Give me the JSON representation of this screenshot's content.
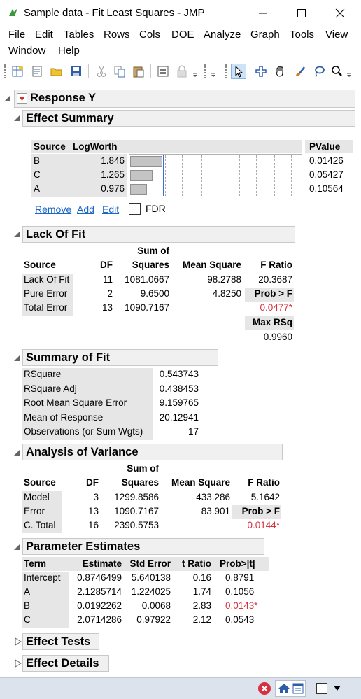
{
  "window": {
    "title": "Sample data - Fit Least Squares - JMP"
  },
  "menu": [
    "File",
    "Edit",
    "Tables",
    "Rows",
    "Cols",
    "DOE",
    "Analyze",
    "Graph",
    "Tools",
    "View",
    "Window",
    "Help"
  ],
  "report": {
    "response_title": "Response Y",
    "effect_summary": {
      "title": "Effect Summary",
      "headers": {
        "source": "Source",
        "logworth": "LogWorth",
        "pvalue": "PValue"
      },
      "rows": [
        {
          "source": "B",
          "logworth": "1.846",
          "pvalue": "0.01426",
          "bar": 1.846
        },
        {
          "source": "C",
          "logworth": "1.265",
          "pvalue": "0.05427",
          "bar": 1.265
        },
        {
          "source": "A",
          "logworth": "0.976",
          "pvalue": "0.10564",
          "bar": 0.976
        }
      ],
      "links": {
        "remove": "Remove",
        "add": "Add",
        "edit": "Edit"
      },
      "fdr_label": "FDR"
    },
    "lack_of_fit": {
      "title": "Lack Of Fit",
      "headers": {
        "source": "Source",
        "df": "DF",
        "ss_top": "Sum of",
        "ss_bottom": "Squares",
        "ms": "Mean Square",
        "f": "F Ratio"
      },
      "rows": [
        {
          "source": "Lack Of Fit",
          "df": "11",
          "ss": "1081.0667",
          "ms": "98.2788",
          "f": "20.3687"
        },
        {
          "source": "Pure Error",
          "df": "2",
          "ss": "9.6500",
          "ms": "4.8250",
          "f": "Prob > F"
        },
        {
          "source": "Total Error",
          "df": "13",
          "ss": "1090.7167",
          "ms": "",
          "f": "0.0477*"
        }
      ],
      "max_rsq_label": "Max RSq",
      "max_rsq_value": "0.9960"
    },
    "summary_of_fit": {
      "title": "Summary of Fit",
      "rows": [
        {
          "label": "RSquare",
          "value": "0.543743"
        },
        {
          "label": "RSquare Adj",
          "value": "0.438453"
        },
        {
          "label": "Root Mean Square Error",
          "value": "9.159765"
        },
        {
          "label": "Mean of Response",
          "value": "20.12941"
        },
        {
          "label": "Observations (or Sum Wgts)",
          "value": "17"
        }
      ]
    },
    "anova": {
      "title": "Analysis of Variance",
      "headers": {
        "source": "Source",
        "df": "DF",
        "ss_top": "Sum of",
        "ss_bottom": "Squares",
        "ms": "Mean Square",
        "f": "F Ratio"
      },
      "rows": [
        {
          "source": "Model",
          "df": "3",
          "ss": "1299.8586",
          "ms": "433.286",
          "f": "5.1642"
        },
        {
          "source": "Error",
          "df": "13",
          "ss": "1090.7167",
          "ms": "83.901",
          "f": "Prob > F"
        },
        {
          "source": "C. Total",
          "df": "16",
          "ss": "2390.5753",
          "ms": "",
          "f": "0.0144*"
        }
      ]
    },
    "parameter_estimates": {
      "title": "Parameter Estimates",
      "headers": {
        "term": "Term",
        "estimate": "Estimate",
        "stderr": "Std Error",
        "t": "t Ratio",
        "p": "Prob>|t|"
      },
      "rows": [
        {
          "term": "Intercept",
          "estimate": "0.8746499",
          "stderr": "5.640138",
          "t": "0.16",
          "p": "0.8791",
          "sig": false
        },
        {
          "term": "A",
          "estimate": "2.1285714",
          "stderr": "1.224025",
          "t": "1.74",
          "p": "0.1056",
          "sig": false
        },
        {
          "term": "B",
          "estimate": "0.0192262",
          "stderr": "0.0068",
          "t": "2.83",
          "p": "0.0143*",
          "sig": true
        },
        {
          "term": "C",
          "estimate": "2.0714286",
          "stderr": "0.97922",
          "t": "2.12",
          "p": "0.0543",
          "sig": false
        }
      ]
    },
    "effect_tests_title": "Effect Tests",
    "effect_details_title": "Effect Details"
  },
  "colors": {
    "accent_red": "#d9303f",
    "link_blue": "#1a66c9",
    "status_bg": "#dce3ec"
  }
}
